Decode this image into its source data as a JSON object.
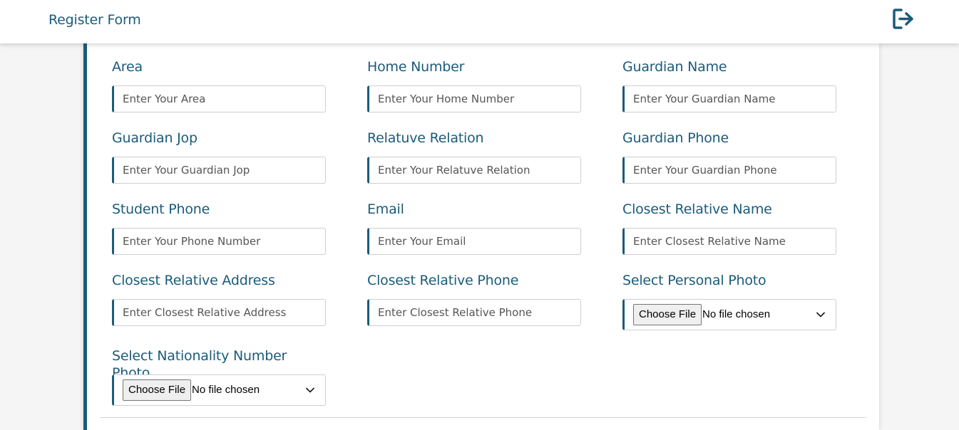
{
  "header": {
    "title": "Register Form",
    "logout_icon": "logout-icon"
  },
  "form": {
    "fields": [
      {
        "label": "Area",
        "placeholder": "Enter Your Area"
      },
      {
        "label": "Home Number",
        "placeholder": "Enter Your Home Number"
      },
      {
        "label": "Guardian Name",
        "placeholder": "Enter Your Guardian Name"
      },
      {
        "label": "Guardian Jop",
        "placeholder": "Enter Your Guardian Jop"
      },
      {
        "label": "Relatuve Relation",
        "placeholder": "Enter Your Relatuve Relation"
      },
      {
        "label": "Guardian Phone",
        "placeholder": "Enter Your Guardian Phone"
      },
      {
        "label": "Student Phone",
        "placeholder": "Enter Your Phone Number"
      },
      {
        "label": "Email",
        "placeholder": "Enter Your Email"
      },
      {
        "label": "Closest Relative Name",
        "placeholder": "Enter Closest Relative Name"
      },
      {
        "label": "Closest Relative Address",
        "placeholder": "Enter Closest Relative Address"
      },
      {
        "label": "Closest Relative Phone",
        "placeholder": "Enter Closest Relative Phone"
      }
    ],
    "file_fields": [
      {
        "label": "Select Personal Photo",
        "button": "Choose File",
        "status": "No file chosen"
      },
      {
        "label": "Select Nationality Number Photo",
        "button": "Choose File",
        "status": "No file chosen"
      }
    ]
  },
  "colors": {
    "accent": "#1b5b7a",
    "background": "#f5f5f5",
    "card": "#ffffff"
  }
}
